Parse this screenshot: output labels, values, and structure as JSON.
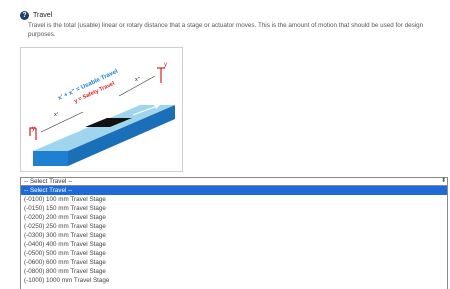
{
  "help": {
    "title": "Travel",
    "text": "Travel is the total (usable) linear or rotary distance that a stage or actuator moves. This is the amount of motion that should be used for design purposes.",
    "icon": "question-circle-icon"
  },
  "diagram": {
    "formula": "x' + x\" = Usable Travel",
    "safety": "y = Safety Travel",
    "label_x1": "x'",
    "label_x2": "x\"",
    "label_y": "y",
    "colors": {
      "base": "#1f7fd1",
      "top": "#9fd6ee",
      "carriage": "#111111",
      "stop": "#d42020"
    }
  },
  "select": {
    "value": "-- Select Travel --",
    "options": [
      "-- Select Travel --",
      "(-0100) 100 mm Travel Stage",
      "(-0150) 150 mm Travel Stage",
      "(-0200) 200 mm Travel Stage",
      "(-0250) 250 mm Travel Stage",
      "(-0300) 300 mm Travel Stage",
      "(-0400) 400 mm Travel Stage",
      "(-0500) 500 mm Travel Stage",
      "(-0600) 600 mm Travel Stage",
      "(-0800) 800 mm Travel Stage",
      "(-1000) 1000 mm Travel Stage"
    ],
    "selected_index": 0
  }
}
